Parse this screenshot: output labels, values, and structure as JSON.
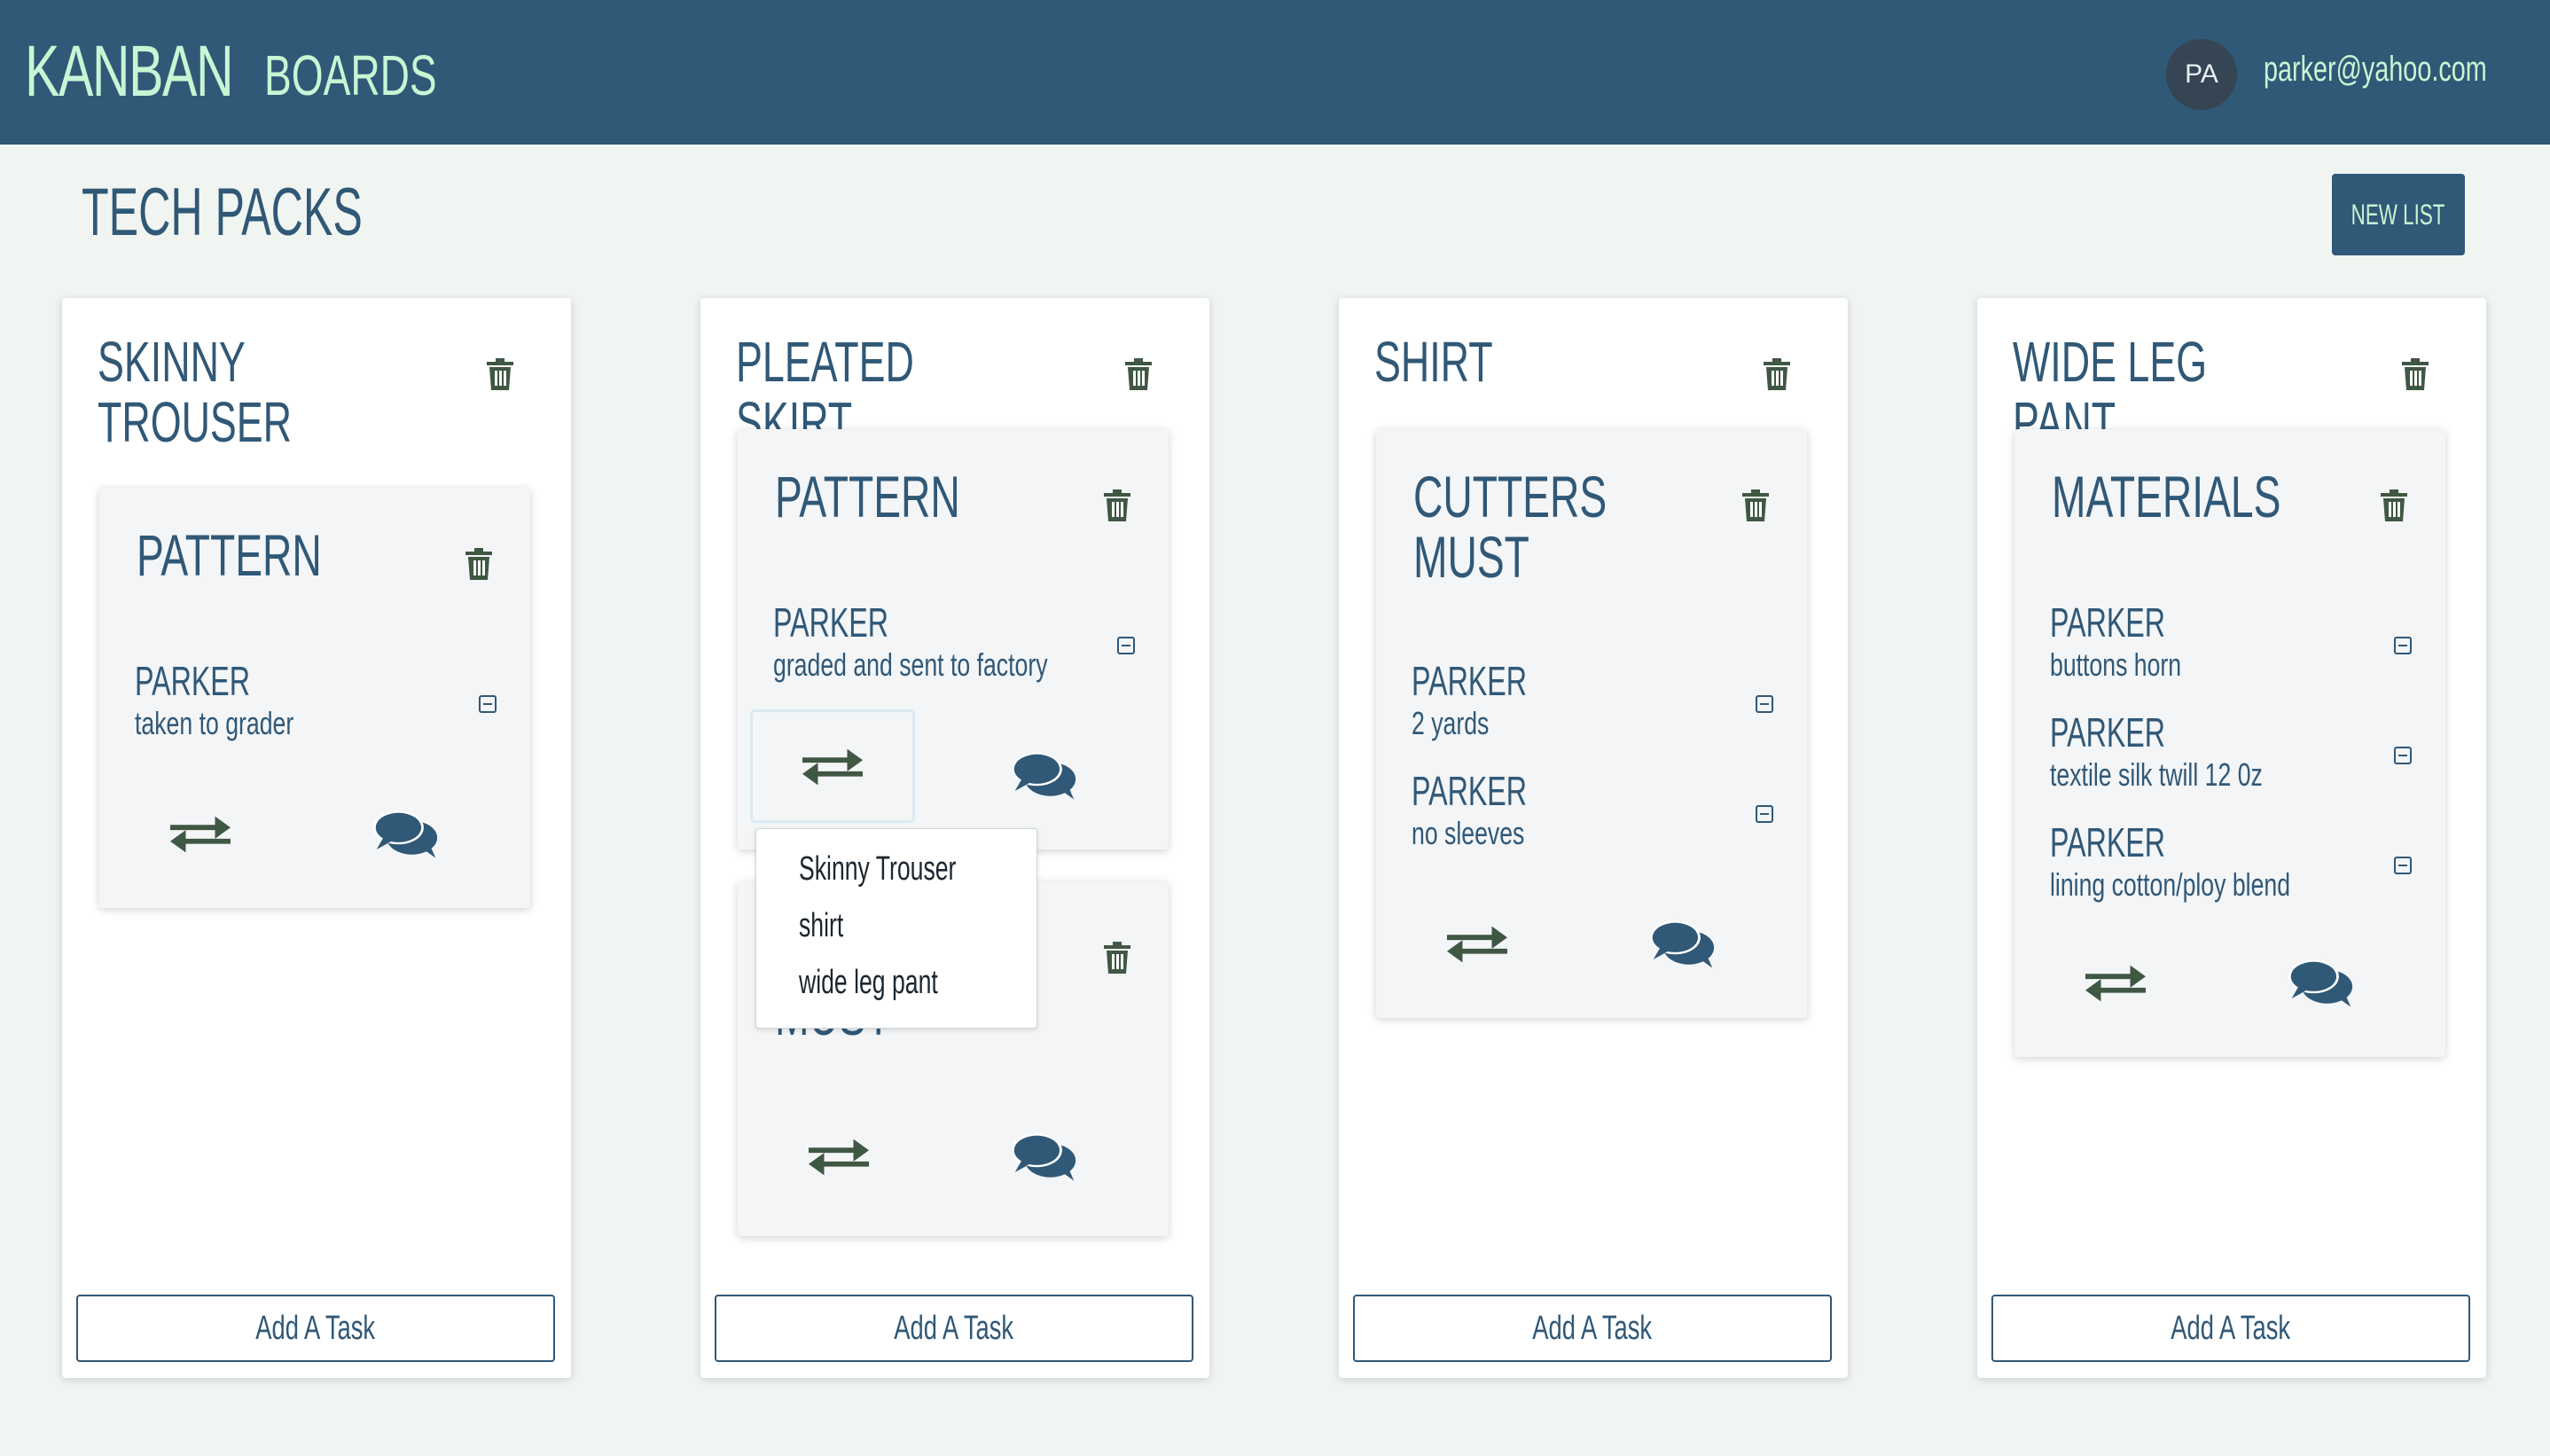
{
  "header": {
    "brand": "KANBAN",
    "boards_link": "BOARDS",
    "avatar_initials": "PA",
    "user_email": "parker@yahoo.com"
  },
  "board": {
    "title": "TECH PACKS",
    "new_list_label": "NEW LIST"
  },
  "colors": {
    "primary": "#305877",
    "accent": "#c7f6d4",
    "background": "#f1f5f1",
    "icon_dark": "#3f5743"
  },
  "lists": [
    {
      "title": "SKINNY\nTROUSER",
      "add_task_label": "Add A Task",
      "cards": [
        {
          "title": "PATTERN",
          "tasks": [
            {
              "author": "PARKER",
              "text": "taken to grader"
            }
          ]
        }
      ]
    },
    {
      "title": "PLEATED SKIRT",
      "add_task_label": "Add A Task",
      "cards": [
        {
          "title": "PATTERN",
          "tasks": [
            {
              "author": "PARKER",
              "text": "graded and sent to factory"
            }
          ]
        },
        {
          "title": "MUST",
          "tasks": []
        }
      ]
    },
    {
      "title": "SHIRT",
      "add_task_label": "Add A Task",
      "cards": [
        {
          "title": "CUTTERS\nMUST",
          "tasks": [
            {
              "author": "PARKER",
              "text": "2 yards"
            },
            {
              "author": "PARKER",
              "text": "no sleeves"
            }
          ]
        }
      ]
    },
    {
      "title": "WIDE LEG PANT",
      "add_task_label": "Add A Task",
      "cards": [
        {
          "title": "MATERIALS",
          "tasks": [
            {
              "author": "PARKER",
              "text": "buttons horn"
            },
            {
              "author": "PARKER",
              "text": "textile silk twill 12 0z"
            },
            {
              "author": "PARKER",
              "text": "lining cotton/ploy blend"
            }
          ]
        }
      ]
    }
  ],
  "move_dropdown": {
    "options": [
      "Skinny Trouser",
      "shirt",
      "wide leg pant"
    ]
  },
  "icons": {
    "trash": "trash-icon",
    "minus": "minus-square-icon",
    "move": "exchange-arrows-icon",
    "comments": "comments-icon"
  }
}
